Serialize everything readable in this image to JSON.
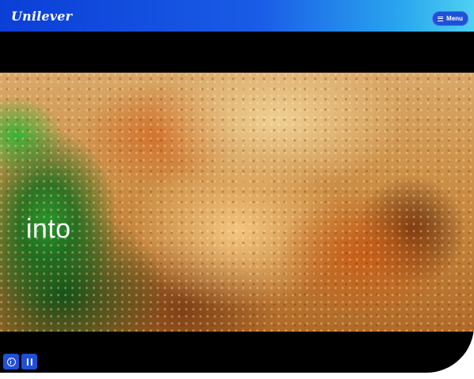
{
  "header": {
    "logo_text": "Unilever",
    "menu_label": "Menu",
    "menu_icon": "hamburger-icon"
  },
  "video": {
    "caption": "into"
  },
  "controls": {
    "info_icon": "info-icon",
    "pause_icon": "pause-icon"
  },
  "colors": {
    "brand_blue": "#1f50d8",
    "header_gradient_start": "#0b3fd6",
    "header_gradient_end": "#4fd0f2",
    "video_background": "#000000"
  }
}
